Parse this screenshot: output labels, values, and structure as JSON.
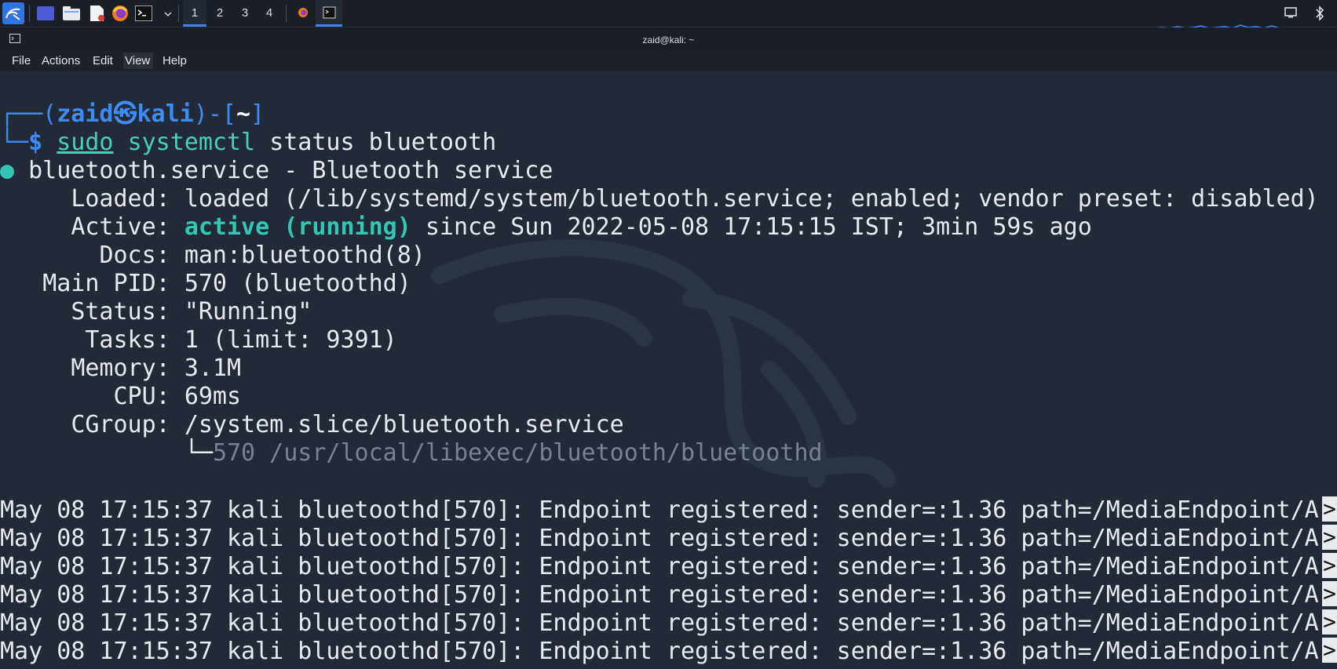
{
  "window": {
    "title": "zaid@kali: ~"
  },
  "panel": {
    "workspaces": [
      "1",
      "2",
      "3",
      "4"
    ],
    "active_workspace": "1"
  },
  "menubar": {
    "items": [
      "File",
      "Actions",
      "Edit",
      "View",
      "Help"
    ]
  },
  "prompt": {
    "open": "┌──(",
    "user": "zaid",
    "host_sep": "㉿",
    "host": "kali",
    "close": ")-[",
    "path": "~",
    "end": "]",
    "corner": "└─",
    "dollar": "$",
    "sudo": "sudo",
    "cmd": "systemctl",
    "args": "status bluetooth"
  },
  "service": {
    "bullet": "●",
    "header": "bluetooth.service - Bluetooth service",
    "loaded_label": "Loaded:",
    "loaded_value": "loaded (/lib/systemd/system/bluetooth.service; enabled; vendor preset: disabled)",
    "active_label": "Active:",
    "active_state": "active (running)",
    "active_since": "since Sun 2022-05-08 17:15:15 IST; 3min 59s ago",
    "docs_label": "Docs:",
    "docs_value": "man:bluetoothd(8)",
    "pid_label": "Main PID:",
    "pid_value": "570 (bluetoothd)",
    "status_label": "Status:",
    "status_value": "\"Running\"",
    "tasks_label": "Tasks:",
    "tasks_value": "1 (limit: 9391)",
    "memory_label": "Memory:",
    "memory_value": "3.1M",
    "cpu_label": "CPU:",
    "cpu_value": "69ms",
    "cgroup_label": "CGroup:",
    "cgroup_value": "/system.slice/bluetooth.service",
    "cgroup_tree": "└─",
    "cgroup_proc": "570 /usr/local/libexec/bluetooth/bluetoothd"
  },
  "log": {
    "lines": [
      "May 08 17:15:37 kali bluetoothd[570]: Endpoint registered: sender=:1.36 path=/MediaEndpoint/A",
      "May 08 17:15:37 kali bluetoothd[570]: Endpoint registered: sender=:1.36 path=/MediaEndpoint/A",
      "May 08 17:15:37 kali bluetoothd[570]: Endpoint registered: sender=:1.36 path=/MediaEndpoint/A",
      "May 08 17:15:37 kali bluetoothd[570]: Endpoint registered: sender=:1.36 path=/MediaEndpoint/A",
      "May 08 17:15:37 kali bluetoothd[570]: Endpoint registered: sender=:1.36 path=/MediaEndpoint/A",
      "May 08 17:15:37 kali bluetoothd[570]: Endpoint registered: sender=:1.36 path=/MediaEndpoint/A"
    ],
    "truncate_marker": ">"
  },
  "colors": {
    "accent": "#3d8bf5",
    "active_state": "#34c6b2",
    "terminal_bg": "#222a37"
  }
}
